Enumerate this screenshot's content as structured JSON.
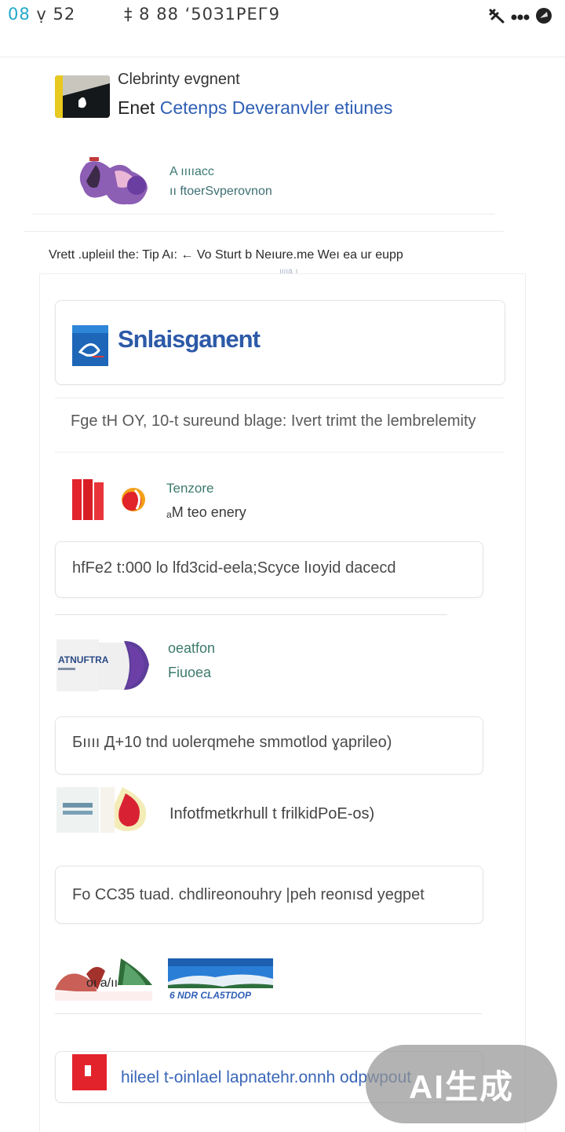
{
  "status_bar": {
    "time_prefix": "08",
    "time_rest": "ṿ 52",
    "info": "‡ 8  88 ‘50З1РЕГ9"
  },
  "header": {
    "subtitle": "Clebrinty evgnent",
    "title_prefix": "Enet",
    "title_link": "Cetenps Deveranvler etiunes"
  },
  "promo": {
    "tag": "A ııııасс",
    "subtitle": "ıı ftoerSvperovnon"
  },
  "notice": "Vrett .upleiıl the: Tip Aı: ← Vo Sturt b Neıure.me Weı eа ur eupр",
  "notice_small": "ııııа  ı",
  "brand": {
    "name": "Snlaisganent"
  },
  "question": "Fge tH OY, 10-t sureund blage: Ivert trimt the lembrelemity",
  "items": [
    {
      "tag": "Tenzore",
      "title": "ₐM teo  enery"
    },
    {
      "tag": "oeatfon",
      "title": "Fiuoea"
    },
    {
      "title": "Infotfmetkrhull t frilkidPoE-os)"
    }
  ],
  "fields": [
    "hfFe2 t:000  lo lfd3cid-eela;Scyce lıoyid dаcecd",
    "Бıııı Д+10 tnd uolerqmehe smmotlod ɣaprileo)",
    "Fo CС35 tuad. chdlireonouhry |peh reonısd yegpet"
  ],
  "images": {
    "thumb_label": "ATNUFTRA",
    "banner_caption": "6 NDR CLA5TDOP",
    "logo_text": "oı a/ıı"
  },
  "bottom_link": "hileel t-oinlael lapnatehr.onnh odpwpout",
  "watermark": "AI生成",
  "colors": {
    "accent_blue": "#2f5fb5",
    "teal_text": "#3c7a6b",
    "status_cyan": "#22a9c9",
    "red": "#e3232b",
    "purple": "#5d3e9a"
  }
}
